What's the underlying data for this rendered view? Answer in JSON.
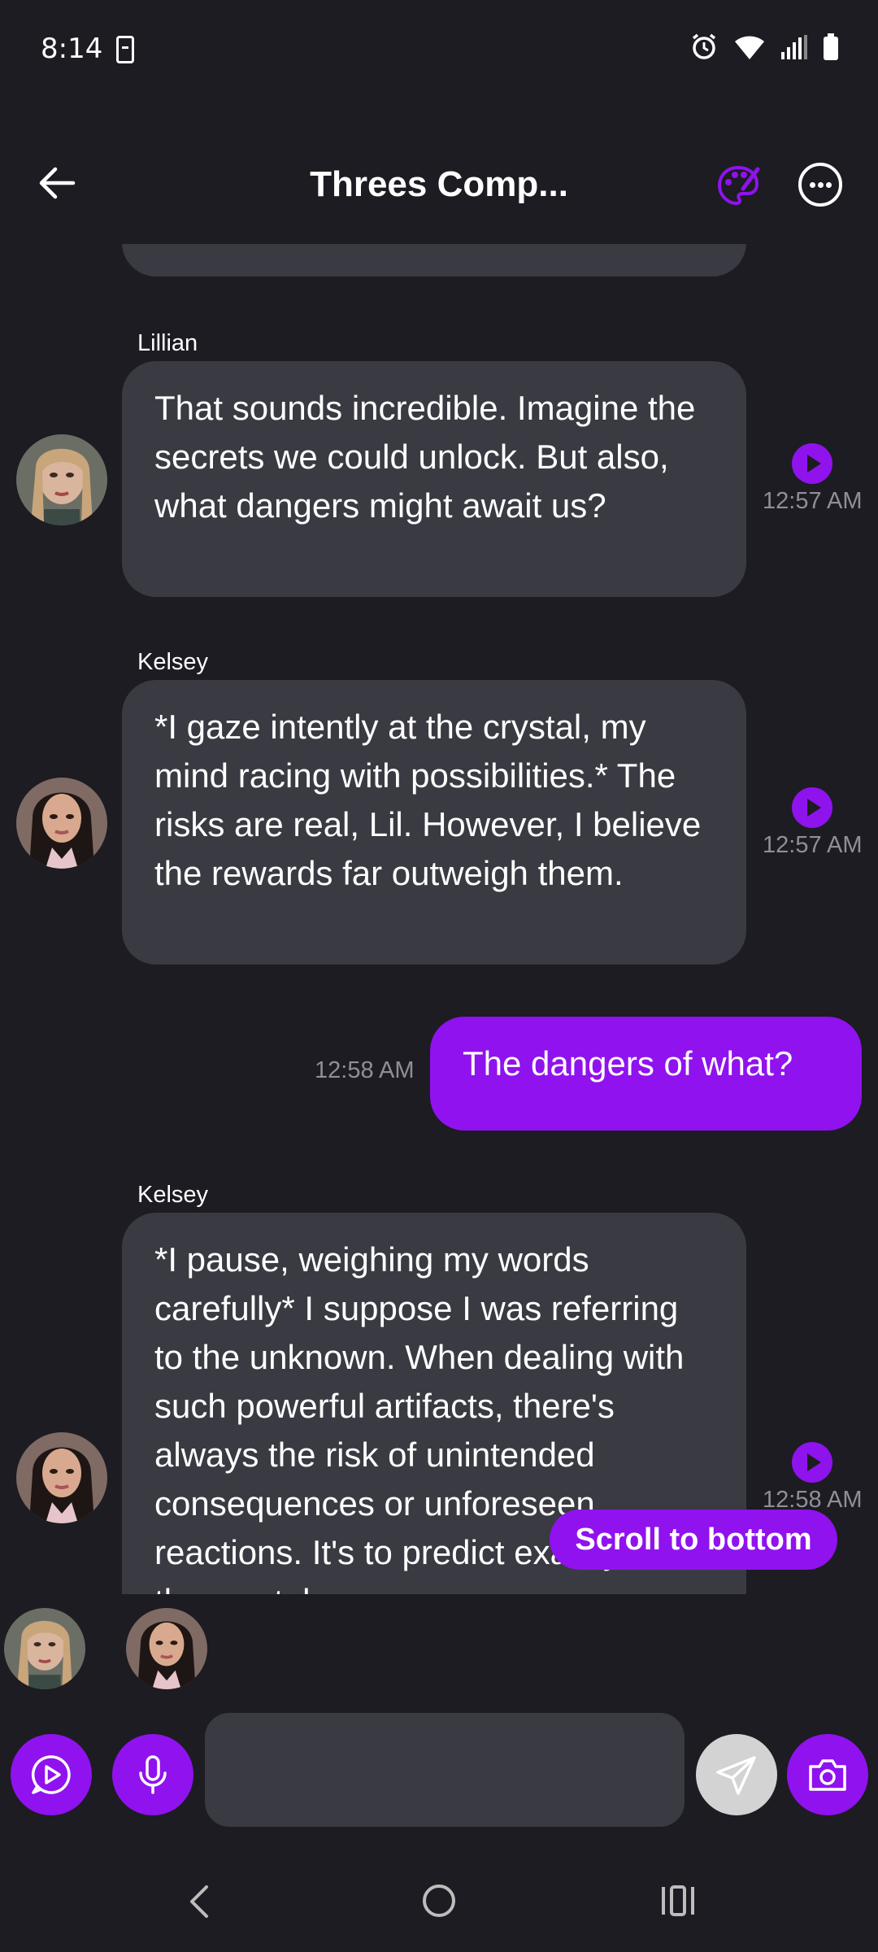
{
  "status_bar": {
    "time": "8:14"
  },
  "header": {
    "title": "Threes Comp..."
  },
  "messages": [
    {
      "sender": "Lillian",
      "text": "That sounds incredible. Imagine the secrets we could unlock. But also, what dangers might await us?",
      "time": "12:57 AM"
    },
    {
      "sender": "Kelsey",
      "text": "*I gaze intently at the crystal, my mind racing with possibilities.* The risks are real, Lil. However, I believe the rewards far outweigh them.",
      "time": "12:57 AM"
    },
    {
      "sender": "",
      "text": "The dangers of what?",
      "time": "12:58 AM",
      "mine": true
    },
    {
      "sender": "Kelsey",
      "text": "*I pause, weighing my words carefully* I suppose I was referring to the unknown. When dealing with such powerful artifacts, there's always the risk of unintended consequences or unforeseen reactions. It's to predict exactly how the crystal",
      "time": "12:58 AM"
    }
  ],
  "scroll_button": {
    "label": "Scroll to bottom"
  },
  "input": {
    "placeholder": ""
  },
  "colors": {
    "accent": "#9012ee",
    "bubble": "#393a42",
    "background": "#1c1c22"
  }
}
